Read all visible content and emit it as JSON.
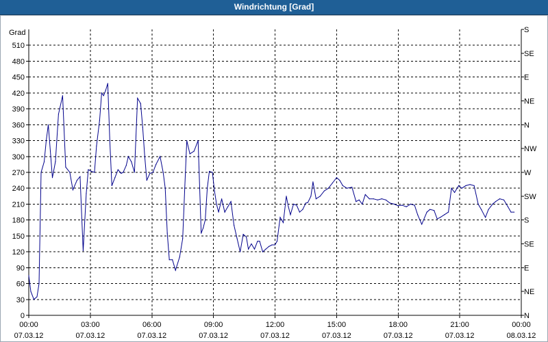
{
  "window": {
    "title": "Windrichtung [Grad]"
  },
  "chart_data": {
    "type": "line",
    "title": "Windrichtung [Grad]",
    "ylabel": "Grad",
    "ylim": [
      0,
      540
    ],
    "y_ticks": [
      0,
      30,
      60,
      90,
      120,
      150,
      180,
      210,
      240,
      270,
      300,
      330,
      360,
      390,
      420,
      450,
      480,
      510
    ],
    "y2_ticks": [
      {
        "value": 0,
        "label": "N"
      },
      {
        "value": 45,
        "label": "NE"
      },
      {
        "value": 90,
        "label": "E"
      },
      {
        "value": 135,
        "label": "SE"
      },
      {
        "value": 180,
        "label": "S"
      },
      {
        "value": 225,
        "label": "SW"
      },
      {
        "value": 270,
        "label": "W"
      },
      {
        "value": 315,
        "label": "NW"
      },
      {
        "value": 360,
        "label": "N"
      },
      {
        "value": 405,
        "label": "NE"
      },
      {
        "value": 450,
        "label": "E"
      },
      {
        "value": 495,
        "label": "SE"
      },
      {
        "value": 540,
        "label": "S"
      }
    ],
    "x_ticks": [
      {
        "value": 0,
        "time": "00:00",
        "date": "07.03.12"
      },
      {
        "value": 3,
        "time": "03:00",
        "date": "07.03.12"
      },
      {
        "value": 6,
        "time": "06:00",
        "date": "07.03.12"
      },
      {
        "value": 9,
        "time": "09:00",
        "date": "07.03.12"
      },
      {
        "value": 12,
        "time": "12:00",
        "date": "07.03.12"
      },
      {
        "value": 15,
        "time": "15:00",
        "date": "07.03.12"
      },
      {
        "value": 18,
        "time": "18:00",
        "date": "07.03.12"
      },
      {
        "value": 21,
        "time": "21:00",
        "date": "07.03.12"
      },
      {
        "value": 24,
        "time": "00:00",
        "date": "08.03.12"
      }
    ],
    "xlim": [
      0,
      24
    ],
    "grid": true,
    "series": [
      {
        "color": "#00008b",
        "points": [
          [
            0.0,
            75
          ],
          [
            0.1,
            45
          ],
          [
            0.25,
            30
          ],
          [
            0.4,
            35
          ],
          [
            0.5,
            60
          ],
          [
            0.6,
            270
          ],
          [
            0.75,
            290
          ],
          [
            0.85,
            330
          ],
          [
            0.95,
            360
          ],
          [
            1.05,
            310
          ],
          [
            1.15,
            260
          ],
          [
            1.3,
            290
          ],
          [
            1.45,
            380
          ],
          [
            1.65,
            415
          ],
          [
            1.8,
            280
          ],
          [
            2.0,
            270
          ],
          [
            2.15,
            237
          ],
          [
            2.35,
            255
          ],
          [
            2.5,
            262
          ],
          [
            2.65,
            122
          ],
          [
            2.8,
            230
          ],
          [
            2.9,
            275
          ],
          [
            3.05,
            272
          ],
          [
            3.2,
            270
          ],
          [
            3.3,
            320
          ],
          [
            3.45,
            368
          ],
          [
            3.55,
            420
          ],
          [
            3.65,
            415
          ],
          [
            3.75,
            425
          ],
          [
            3.85,
            438
          ],
          [
            3.95,
            330
          ],
          [
            4.05,
            245
          ],
          [
            4.2,
            260
          ],
          [
            4.35,
            275
          ],
          [
            4.5,
            268
          ],
          [
            4.6,
            270
          ],
          [
            4.75,
            283
          ],
          [
            4.85,
            300
          ],
          [
            5.0,
            290
          ],
          [
            5.15,
            270
          ],
          [
            5.3,
            410
          ],
          [
            5.45,
            400
          ],
          [
            5.55,
            355
          ],
          [
            5.65,
            300
          ],
          [
            5.75,
            255
          ],
          [
            5.9,
            268
          ],
          [
            6.05,
            270
          ],
          [
            6.2,
            285
          ],
          [
            6.4,
            300
          ],
          [
            6.55,
            270
          ],
          [
            6.65,
            240
          ],
          [
            6.75,
            155
          ],
          [
            6.85,
            105
          ],
          [
            7.0,
            105
          ],
          [
            7.15,
            85
          ],
          [
            7.35,
            110
          ],
          [
            7.5,
            145
          ],
          [
            7.6,
            240
          ],
          [
            7.7,
            330
          ],
          [
            7.85,
            305
          ],
          [
            8.05,
            310
          ],
          [
            8.25,
            330
          ],
          [
            8.4,
            155
          ],
          [
            8.5,
            165
          ],
          [
            8.6,
            180
          ],
          [
            8.7,
            240
          ],
          [
            8.8,
            272
          ],
          [
            8.95,
            270
          ],
          [
            9.05,
            235
          ],
          [
            9.15,
            210
          ],
          [
            9.25,
            195
          ],
          [
            9.4,
            220
          ],
          [
            9.55,
            195
          ],
          [
            9.7,
            205
          ],
          [
            9.85,
            215
          ],
          [
            10.0,
            170
          ],
          [
            10.15,
            145
          ],
          [
            10.3,
            120
          ],
          [
            10.45,
            153
          ],
          [
            10.6,
            148
          ],
          [
            10.7,
            125
          ],
          [
            10.85,
            135
          ],
          [
            11.0,
            125
          ],
          [
            11.15,
            140
          ],
          [
            11.25,
            140
          ],
          [
            11.4,
            120
          ],
          [
            11.55,
            125
          ],
          [
            11.7,
            130
          ],
          [
            11.85,
            133
          ],
          [
            12.0,
            133
          ],
          [
            12.1,
            140
          ],
          [
            12.25,
            185
          ],
          [
            12.4,
            175
          ],
          [
            12.55,
            225
          ],
          [
            12.65,
            205
          ],
          [
            12.75,
            190
          ],
          [
            12.9,
            210
          ],
          [
            13.05,
            208
          ],
          [
            13.2,
            195
          ],
          [
            13.35,
            200
          ],
          [
            13.5,
            212
          ],
          [
            13.6,
            213
          ],
          [
            13.75,
            225
          ],
          [
            13.85,
            252
          ],
          [
            14.0,
            220
          ],
          [
            14.2,
            225
          ],
          [
            14.4,
            235
          ],
          [
            14.6,
            240
          ],
          [
            14.8,
            250
          ],
          [
            15.0,
            260
          ],
          [
            15.15,
            255
          ],
          [
            15.3,
            245
          ],
          [
            15.5,
            240
          ],
          [
            15.75,
            242
          ],
          [
            15.95,
            215
          ],
          [
            16.1,
            218
          ],
          [
            16.25,
            210
          ],
          [
            16.4,
            228
          ],
          [
            16.6,
            220
          ],
          [
            16.8,
            220
          ],
          [
            17.0,
            218
          ],
          [
            17.2,
            220
          ],
          [
            17.4,
            218
          ],
          [
            17.6,
            212
          ],
          [
            17.8,
            210
          ],
          [
            18.0,
            207
          ],
          [
            18.2,
            208
          ],
          [
            18.4,
            205
          ],
          [
            18.6,
            210
          ],
          [
            18.8,
            208
          ],
          [
            18.95,
            190
          ],
          [
            19.15,
            172
          ],
          [
            19.4,
            195
          ],
          [
            19.55,
            200
          ],
          [
            19.75,
            198
          ],
          [
            19.9,
            182
          ],
          [
            20.05,
            185
          ],
          [
            20.25,
            190
          ],
          [
            20.45,
            195
          ],
          [
            20.6,
            240
          ],
          [
            20.75,
            232
          ],
          [
            20.95,
            245
          ],
          [
            21.1,
            240
          ],
          [
            21.3,
            245
          ],
          [
            21.5,
            247
          ],
          [
            21.7,
            245
          ],
          [
            21.9,
            210
          ],
          [
            22.05,
            200
          ],
          [
            22.25,
            185
          ],
          [
            22.4,
            200
          ],
          [
            22.6,
            210
          ],
          [
            22.75,
            215
          ],
          [
            22.95,
            220
          ],
          [
            23.15,
            218
          ],
          [
            23.35,
            205
          ],
          [
            23.5,
            195
          ],
          [
            23.65,
            195
          ]
        ]
      }
    ]
  }
}
